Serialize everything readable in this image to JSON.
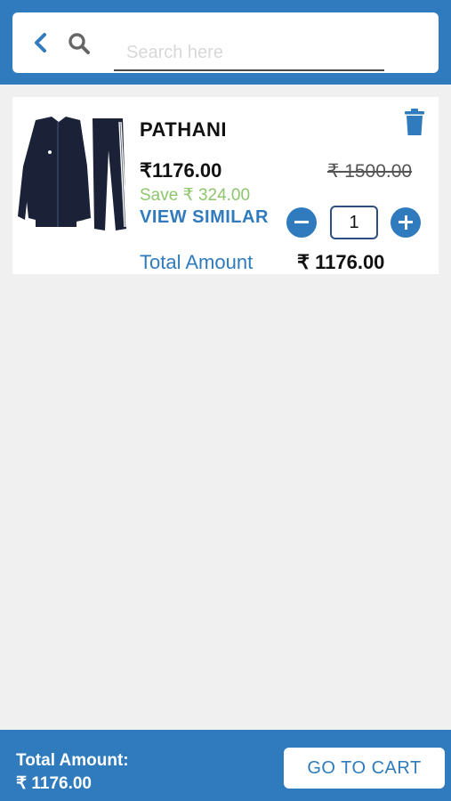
{
  "header": {
    "back_icon": "chevron-left-icon",
    "search_icon": "magnifier-icon",
    "search_placeholder": "Search here",
    "search_value": ""
  },
  "cart_item": {
    "name": "PATHANI",
    "price": "₹1176.00",
    "mrp": "₹ 1500.00",
    "save_text": "Save ₹ 324.00",
    "view_similar": "VIEW SIMILAR",
    "quantity": "1",
    "total_label": "Total Amount",
    "total_value": "₹ 1176.00",
    "delete_icon": "trash-icon"
  },
  "footer": {
    "total_label": "Total Amount:",
    "total_value": "₹ 1176.00",
    "cta_label": "GO TO CART"
  },
  "colors": {
    "primary": "#2f7bbd",
    "save_green": "#8cc66d",
    "background": "#f0f0f0"
  }
}
